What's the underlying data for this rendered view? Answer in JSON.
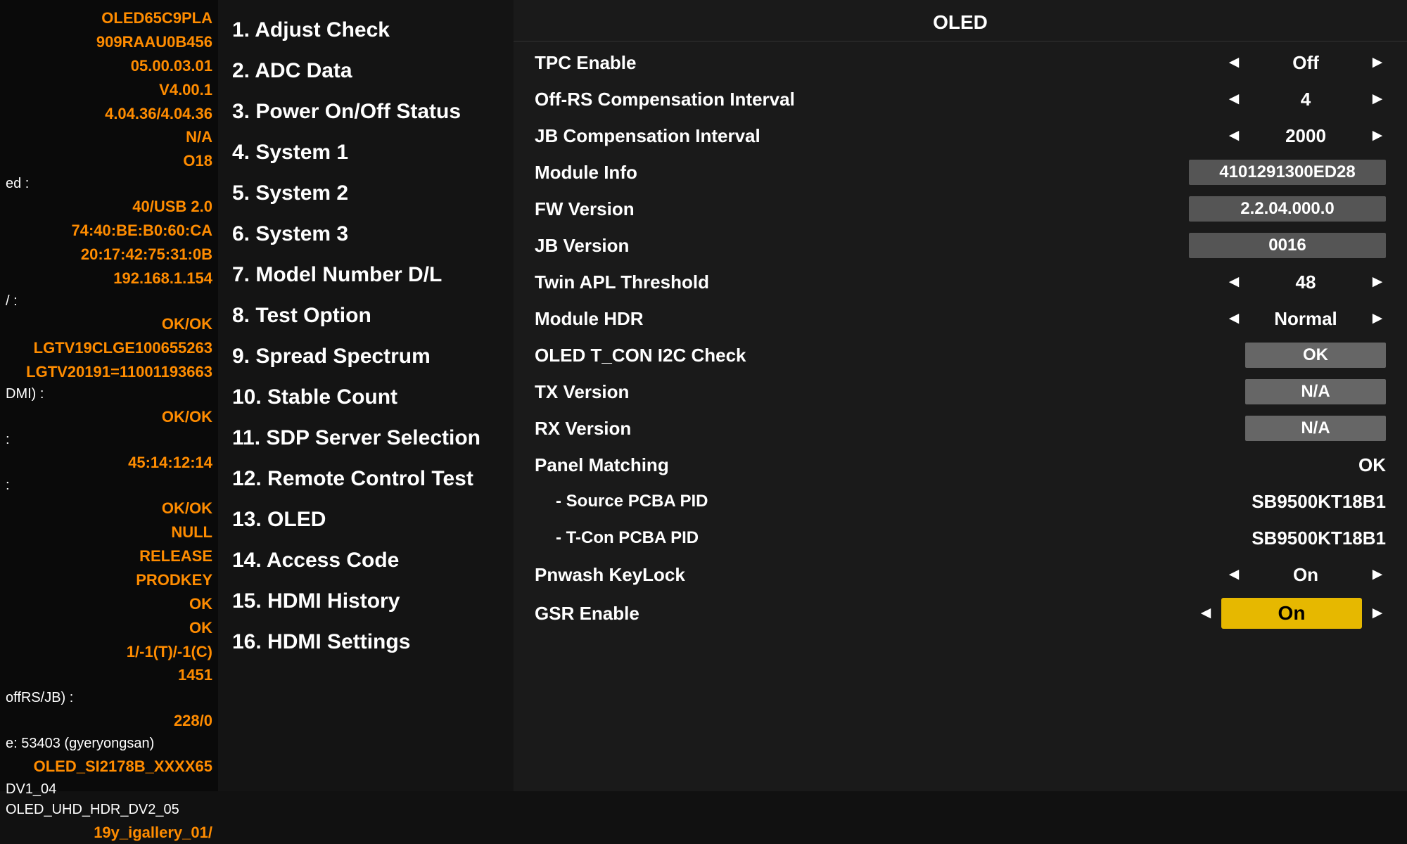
{
  "left_panel": {
    "lines": [
      {
        "text": "OLED65C9PLA",
        "type": "info"
      },
      {
        "text": "909RAAU0B456",
        "type": "info"
      },
      {
        "text": "05.00.03.01",
        "type": "info"
      },
      {
        "text": "V4.00.1",
        "type": "info"
      },
      {
        "text": "4.04.36/4.04.36",
        "type": "info"
      },
      {
        "text": "N/A",
        "type": "info"
      },
      {
        "text": "O18",
        "type": "info"
      },
      {
        "text": "ed :",
        "type": "label"
      },
      {
        "text": "40/USB 2.0",
        "type": "info"
      },
      {
        "text": "74:40:BE:B0:60:CA",
        "type": "info"
      },
      {
        "text": "20:17:42:75:31:0B",
        "type": "info"
      },
      {
        "text": "192.168.1.154",
        "type": "info"
      },
      {
        "text": "/ :",
        "type": "label"
      },
      {
        "text": "OK/OK",
        "type": "info"
      },
      {
        "text": "LGTV19CLGE100655263",
        "type": "info"
      },
      {
        "text": "LGTV20191=11001193663",
        "type": "info"
      },
      {
        "text": "DMI) :",
        "type": "label"
      },
      {
        "text": "OK/OK",
        "type": "info"
      },
      {
        "text": ":",
        "type": "label"
      },
      {
        "text": "45:14:12:14",
        "type": "info"
      },
      {
        "text": ":",
        "type": "label"
      },
      {
        "text": "OK/OK",
        "type": "info"
      },
      {
        "text": "NULL",
        "type": "info"
      },
      {
        "text": "RELEASE",
        "type": "info"
      },
      {
        "text": "PRODKEY",
        "type": "info"
      },
      {
        "text": "OK",
        "type": "info"
      },
      {
        "text": "OK",
        "type": "info"
      },
      {
        "text": "1/-1(T)/-1(C)",
        "type": "info"
      },
      {
        "text": "1451",
        "type": "info"
      },
      {
        "text": "offRS/JB) :",
        "type": "label"
      },
      {
        "text": "228/0",
        "type": "info"
      },
      {
        "text": "e:  53403 (gyeryongsan)",
        "type": "label"
      },
      {
        "text": "OLED_SI2178B_XXXX65",
        "type": "info"
      },
      {
        "text": "DV1_04 OLED_UHD_HDR_DV2_05",
        "type": "label"
      },
      {
        "text": "19y_igallery_01/",
        "type": "info"
      }
    ]
  },
  "middle_panel": {
    "menu_items": [
      "1. Adjust Check",
      "2. ADC Data",
      "3. Power On/Off Status",
      "4. System 1",
      "5. System 2",
      "6. System 3",
      "7. Model Number D/L",
      "8. Test Option",
      "9. Spread Spectrum",
      "10. Stable Count",
      "11. SDP Server Selection",
      "12. Remote Control Test",
      "13. OLED",
      "14. Access Code",
      "15. HDMI History",
      "16. HDMI Settings"
    ]
  },
  "right_panel": {
    "title": "OLED",
    "settings": [
      {
        "label": "TPC Enable",
        "type": "arrow-value",
        "value": "Off"
      },
      {
        "label": "Off-RS Compensation Interval",
        "type": "arrow-value",
        "value": "4"
      },
      {
        "label": "JB Compensation Interval",
        "type": "arrow-value",
        "value": "2000"
      },
      {
        "label": "Module Info",
        "type": "box",
        "value": "4101291300ED28"
      },
      {
        "label": "FW Version",
        "type": "box",
        "value": "2.2.04.000.0"
      },
      {
        "label": "JB Version",
        "type": "box",
        "value": "0016"
      },
      {
        "label": "Twin APL Threshold",
        "type": "arrow-value",
        "value": "48"
      },
      {
        "label": "Module HDR",
        "type": "arrow-value",
        "value": "Normal"
      },
      {
        "label": "OLED T_CON I2C Check",
        "type": "ok-box",
        "value": "OK"
      },
      {
        "label": "TX Version",
        "type": "ok-box",
        "value": "N/A"
      },
      {
        "label": "RX Version",
        "type": "ok-box",
        "value": "N/A"
      },
      {
        "label": "Panel Matching",
        "type": "plain",
        "value": "OK"
      },
      {
        "label": " - Source PCBA PID",
        "type": "plain-sub",
        "value": "SB9500KT18B1"
      },
      {
        "label": " - T-Con PCBA PID",
        "type": "plain-sub",
        "value": "SB9500KT18B1"
      },
      {
        "label": "Pnwash KeyLock",
        "type": "arrow-value",
        "value": "On"
      },
      {
        "label": "GSR Enable",
        "type": "arrow-highlighted",
        "value": "On"
      }
    ]
  }
}
